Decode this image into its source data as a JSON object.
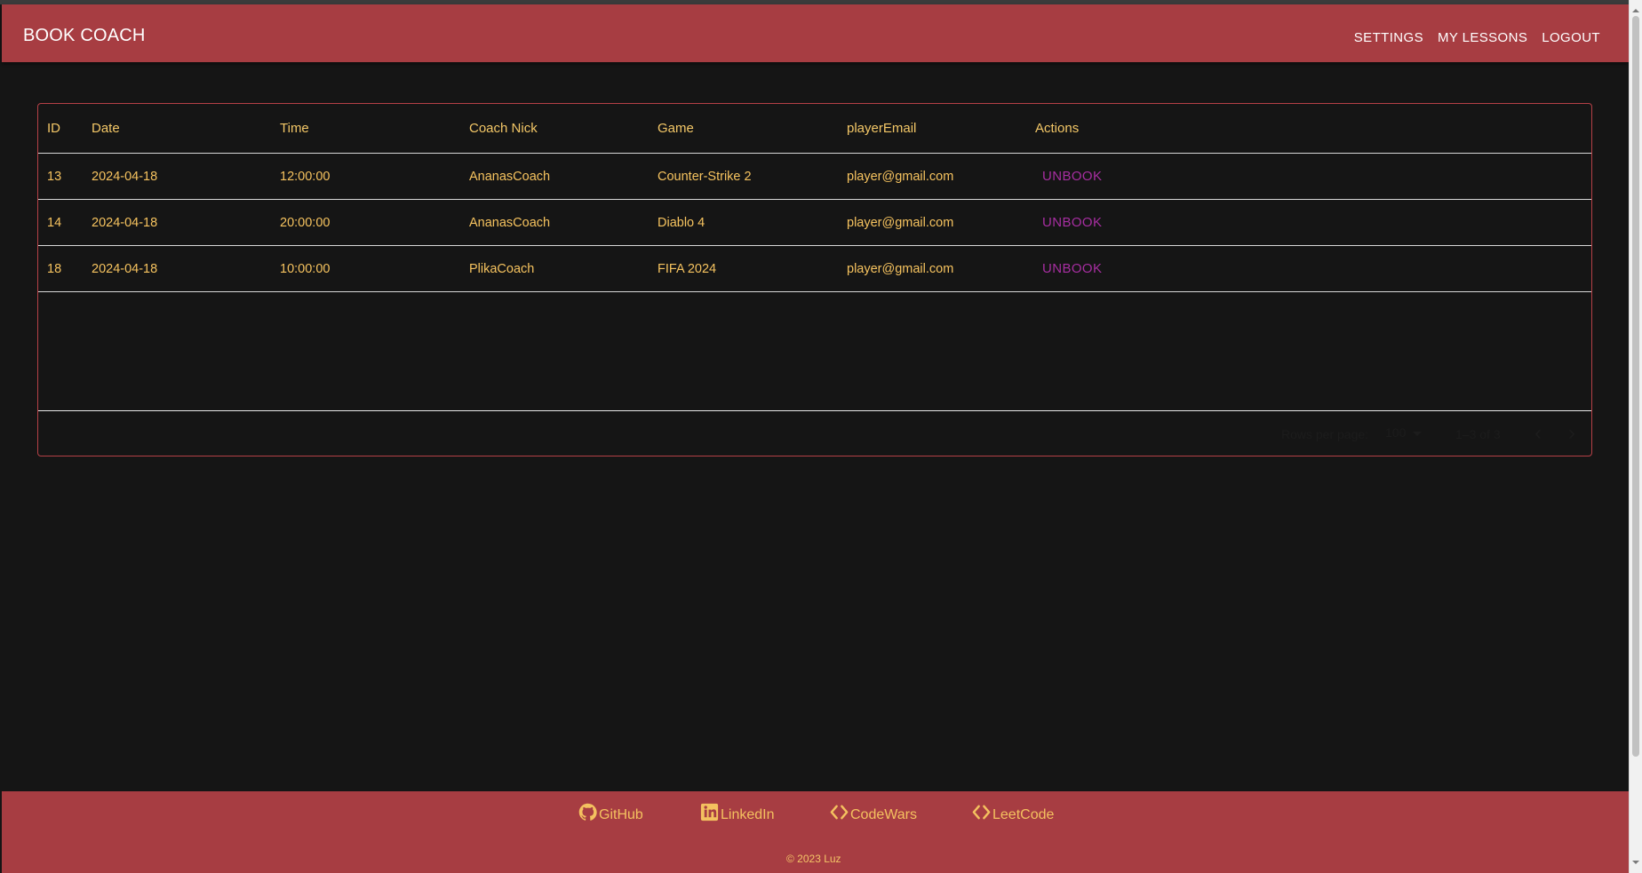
{
  "header": {
    "brand": "BOOK COACH",
    "nav": [
      "SETTINGS",
      "MY LESSONS",
      "LOGOUT"
    ]
  },
  "table": {
    "columns": [
      "ID",
      "Date",
      "Time",
      "Coach Nick",
      "Game",
      "playerEmail",
      "Actions"
    ],
    "rows": [
      {
        "id": "13",
        "date": "2024-04-18",
        "time": "12:00:00",
        "coach": "AnanasCoach",
        "game": "Counter-Strike 2",
        "email": "player@gmail.com",
        "action": "UNBOOK"
      },
      {
        "id": "14",
        "date": "2024-04-18",
        "time": "20:00:00",
        "coach": "AnanasCoach",
        "game": "Diablo 4",
        "email": "player@gmail.com",
        "action": "UNBOOK"
      },
      {
        "id": "18",
        "date": "2024-04-18",
        "time": "10:00:00",
        "coach": "PlikaCoach",
        "game": "FIFA 2024",
        "email": "player@gmail.com",
        "action": "UNBOOK"
      }
    ],
    "pagination": {
      "rows_per_page_label": "Rows per page:",
      "rows_per_page_value": "100",
      "range": "1–3 of 3",
      "prev_icon": "chevron-left-icon",
      "next_icon": "chevron-right-icon"
    }
  },
  "footer": {
    "links": [
      {
        "label": "GitHub",
        "icon": "github-icon"
      },
      {
        "label": "LinkedIn",
        "icon": "linkedin-icon"
      },
      {
        "label": "CodeWars",
        "icon": "code-icon"
      },
      {
        "label": "LeetCode",
        "icon": "code-icon"
      }
    ],
    "copyright": "© 2023 Luz"
  },
  "colors": {
    "accent": "#a73d42",
    "text": "#f6c35f",
    "action": "#a72ea1",
    "background": "#151515"
  }
}
